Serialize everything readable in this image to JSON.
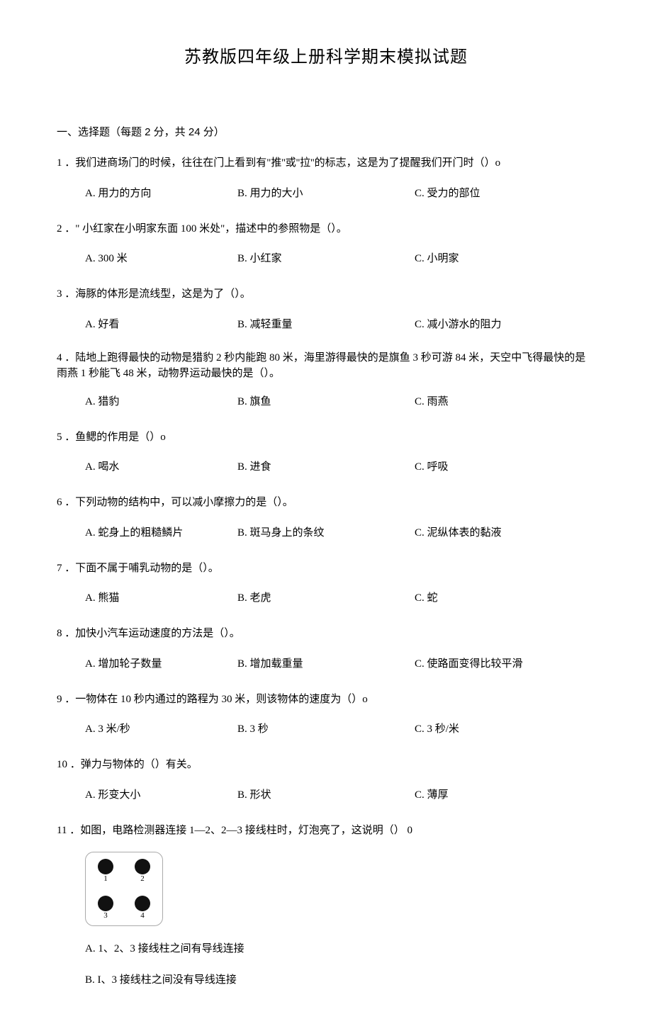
{
  "title": "苏教版四年级上册科学期末模拟试题",
  "section1_header": "一、选择题（每题 2 分，共 24 分）",
  "q1": {
    "stem": "1 ．我们进商场门的时候，往往在门上看到有\"推''或''拉''的标志，这是为了提醒我们开门时（）o",
    "a": "A. 用力的方向",
    "b": "B. 用力的大小",
    "c": "C. 受力的部位"
  },
  "q2": {
    "stem": "2 ．\" 小红家在小明家东面 100 米处\"，描述中的参照物是（）。",
    "a": "A. 300 米",
    "b": "B. 小红家",
    "c": "C. 小明家"
  },
  "q3": {
    "stem": "3 ．海豚的体形是流线型，这是为了（）。",
    "a": "A. 好看",
    "b": "B. 减轻重量",
    "c": "C. 减小游水的阻力"
  },
  "q4": {
    "stem": "4 ．陆地上跑得最快的动物是猎豹 2 秒内能跑 80 米，海里游得最快的是旗鱼 3 秒可游 84 米，天空中飞得最快的是雨燕 1 秒能飞 48 米，动物界运动最快的是（）。",
    "a": "A. 猎豹",
    "b": "B. 旗鱼",
    "c": "C. 雨燕"
  },
  "q5": {
    "stem": "5 ．鱼鳃的作用是（）o",
    "a": "A. 喝水",
    "b": "B. 进食",
    "c": "C. 呼吸"
  },
  "q6": {
    "stem": "6 ．下列动物的结构中，可以减小摩擦力的是（）。",
    "a": "A. 蛇身上的粗糙鳞片",
    "b": "B. 斑马身上的条纹",
    "c": "C. 泥纵体表的黏液"
  },
  "q7": {
    "stem": "7 ．下面不属于哺乳动物的是（）。",
    "a": "A. 熊猫",
    "b": "B. 老虎",
    "c": "C. 蛇"
  },
  "q8": {
    "stem": "8 ．加快小汽车运动速度的方法是（）。",
    "a": "A. 增加轮子数量",
    "b": "B. 增加载重量",
    "c": "C. 使路面变得比较平滑"
  },
  "q9": {
    "stem": "9 ．一物体在 10 秒内通过的路程为 30 米，则该物体的速度为（）o",
    "a": "A. 3 米/秒",
    "b": "B. 3 秒",
    "c": "C. 3 秒/米"
  },
  "q10": {
    "stem": "10 ．弹力与物体的（）有关。",
    "a": "A. 形变大小",
    "b": "B. 形状",
    "c": "C. 薄厚"
  },
  "q11": {
    "stem": "11 ．如图，电路检测器连接 1—2、2—3 接线柱时，灯泡亮了，这说明（） 0",
    "figure_labels": {
      "d1": "1",
      "d2": "2",
      "d3": "3",
      "d4": "4"
    },
    "a": "A.   1、2、3 接线柱之间有导线连接",
    "b": "B.   I、3 接线柱之间没有导线连接"
  }
}
